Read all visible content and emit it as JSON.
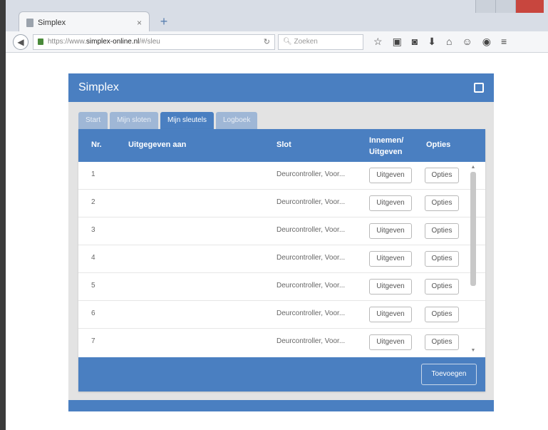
{
  "browser": {
    "tab_title": "Simplex",
    "tab_close": "×",
    "new_tab": "+",
    "url_prefix": "https://www.",
    "url_domain": "simplex-online.nl",
    "url_suffix": "/#/sleu",
    "search_placeholder": "Zoeken",
    "toolbar_icons": [
      "☆",
      "▣",
      "◙",
      "⬇",
      "⌂",
      "☺",
      "◉",
      "≡"
    ]
  },
  "app": {
    "title": "Simplex",
    "tabs": [
      {
        "label": "Start"
      },
      {
        "label": "Mijn sloten"
      },
      {
        "label": "Mijn sleutels",
        "active": true
      },
      {
        "label": "Logboek"
      }
    ],
    "table": {
      "headers": {
        "nr": "Nr.",
        "issued_to": "Uitgegeven aan",
        "lock": "Slot",
        "action_line1": "Innemen/",
        "action_line2": "Uitgeven",
        "options": "Opties"
      },
      "rows": [
        {
          "nr": "1",
          "lock": "Deurcontroller, Voor...",
          "action": "Uitgeven",
          "options": "Opties"
        },
        {
          "nr": "2",
          "lock": "Deurcontroller, Voor...",
          "action": "Uitgeven",
          "options": "Opties"
        },
        {
          "nr": "3",
          "lock": "Deurcontroller, Voor...",
          "action": "Uitgeven",
          "options": "Opties"
        },
        {
          "nr": "4",
          "lock": "Deurcontroller, Voor...",
          "action": "Uitgeven",
          "options": "Opties"
        },
        {
          "nr": "5",
          "lock": "Deurcontroller, Voor...",
          "action": "Uitgeven",
          "options": "Opties"
        },
        {
          "nr": "6",
          "lock": "Deurcontroller, Voor...",
          "action": "Uitgeven",
          "options": "Opties"
        },
        {
          "nr": "7",
          "lock": "Deurcontroller, Voor...",
          "action": "Uitgeven",
          "options": "Opties"
        }
      ]
    },
    "add_button": "Toevoegen",
    "colors": {
      "primary": "#4a7fc1",
      "tab_inactive": "#9fb7d6",
      "background": "#e3e3e3"
    }
  }
}
